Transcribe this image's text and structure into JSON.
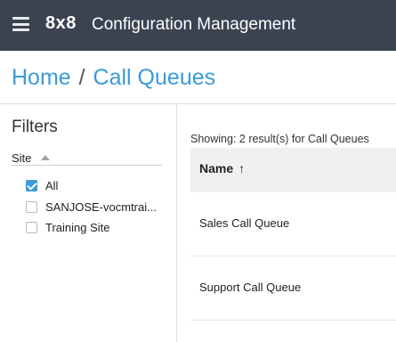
{
  "header": {
    "menu_icon": "hamburger-menu-icon",
    "logo": "8x8",
    "title": "Configuration Management"
  },
  "breadcrumb": {
    "home": "Home",
    "separator": "/",
    "current": "Call Queues"
  },
  "filters": {
    "title": "Filters",
    "site": {
      "label": "Site",
      "sort_icon": "sort-up-icon",
      "options": [
        {
          "label": "All",
          "checked": true
        },
        {
          "label": "SANJOSE-vocmtrai...",
          "checked": false
        },
        {
          "label": "Training Site",
          "checked": false
        }
      ]
    }
  },
  "results": {
    "info": "Showing: 2 result(s) for Call Queues",
    "columns": [
      {
        "label": "Name",
        "sort_icon": "↑"
      }
    ],
    "rows": [
      {
        "name": "Sales Call Queue"
      },
      {
        "name": "Support Call Queue"
      }
    ]
  },
  "colors": {
    "topbar": "#3b4351",
    "accent": "#3a9bd8",
    "table_header": "#eef0f2"
  }
}
